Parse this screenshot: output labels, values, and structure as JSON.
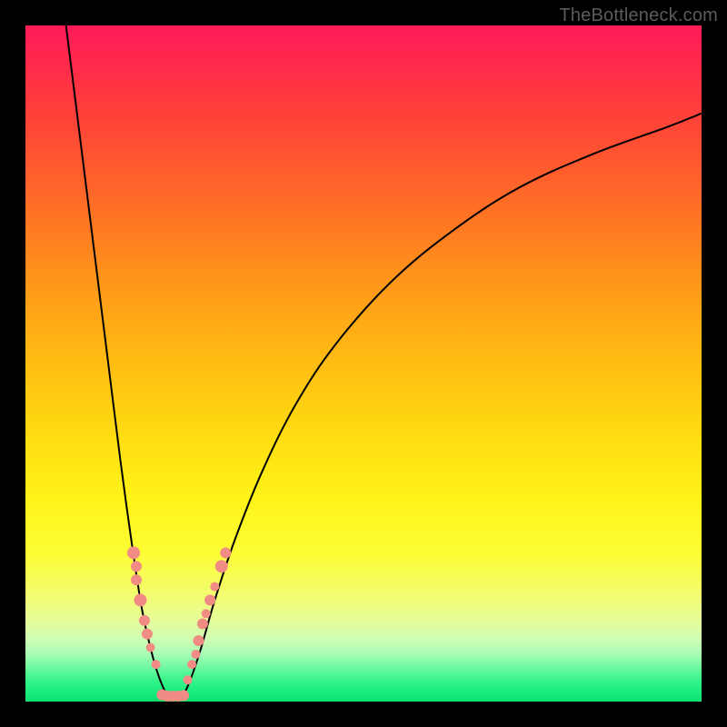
{
  "watermark": "TheBottleneck.com",
  "chart_data": {
    "type": "line",
    "title": "",
    "xlabel": "",
    "ylabel": "",
    "xlim": [
      0,
      100
    ],
    "ylim": [
      0,
      100
    ],
    "axes_visible": false,
    "grid": false,
    "background": {
      "type": "vertical_gradient",
      "stops": [
        {
          "pos": 0.0,
          "color": "#ff1a58"
        },
        {
          "pos": 0.5,
          "color": "#ffc911"
        },
        {
          "pos": 0.8,
          "color": "#fdfd34"
        },
        {
          "pos": 1.0,
          "color": "#0be070"
        }
      ]
    },
    "curves": {
      "left": {
        "x": [
          6.0,
          8.0,
          10.0,
          12.0,
          14.0,
          15.5,
          17.0,
          18.0,
          19.0,
          19.8,
          20.5,
          21.0,
          21.5
        ],
        "y": [
          100.0,
          84.0,
          68.0,
          52.0,
          36.0,
          25.0,
          15.0,
          10.0,
          6.0,
          3.5,
          1.8,
          0.8,
          0.2
        ]
      },
      "right": {
        "x": [
          22.8,
          23.5,
          24.5,
          26.0,
          28.0,
          31.0,
          35.0,
          40.0,
          46.0,
          54.0,
          63.0,
          73.0,
          84.0,
          95.0,
          100.0
        ],
        "y": [
          0.2,
          1.2,
          3.5,
          8.0,
          15.0,
          24.0,
          34.0,
          44.0,
          53.0,
          62.0,
          69.5,
          76.0,
          81.0,
          85.0,
          87.0
        ]
      }
    },
    "markers": [
      {
        "x": 16.0,
        "y": 22.0,
        "r": 7
      },
      {
        "x": 16.4,
        "y": 20.0,
        "r": 6
      },
      {
        "x": 16.4,
        "y": 18.0,
        "r": 6
      },
      {
        "x": 17.0,
        "y": 15.0,
        "r": 7
      },
      {
        "x": 17.6,
        "y": 12.0,
        "r": 6
      },
      {
        "x": 18.0,
        "y": 10.0,
        "r": 6
      },
      {
        "x": 18.5,
        "y": 8.0,
        "r": 5
      },
      {
        "x": 19.3,
        "y": 5.5,
        "r": 5
      },
      {
        "x": 20.2,
        "y": 1.0,
        "r": 6
      },
      {
        "x": 21.0,
        "y": 0.8,
        "r": 6
      },
      {
        "x": 21.8,
        "y": 0.8,
        "r": 6
      },
      {
        "x": 22.6,
        "y": 0.8,
        "r": 6
      },
      {
        "x": 23.4,
        "y": 0.9,
        "r": 6
      },
      {
        "x": 24.0,
        "y": 3.2,
        "r": 5
      },
      {
        "x": 24.6,
        "y": 5.5,
        "r": 5
      },
      {
        "x": 25.2,
        "y": 7.0,
        "r": 5
      },
      {
        "x": 25.6,
        "y": 9.0,
        "r": 6
      },
      {
        "x": 26.2,
        "y": 11.5,
        "r": 6
      },
      {
        "x": 26.7,
        "y": 13.0,
        "r": 5
      },
      {
        "x": 27.3,
        "y": 15.0,
        "r": 6
      },
      {
        "x": 28.0,
        "y": 17.0,
        "r": 5
      },
      {
        "x": 29.0,
        "y": 20.0,
        "r": 7
      },
      {
        "x": 29.6,
        "y": 22.0,
        "r": 6
      }
    ],
    "marker_color": "#f08c84",
    "stroke_color": "#000000",
    "stroke_width": 2
  }
}
